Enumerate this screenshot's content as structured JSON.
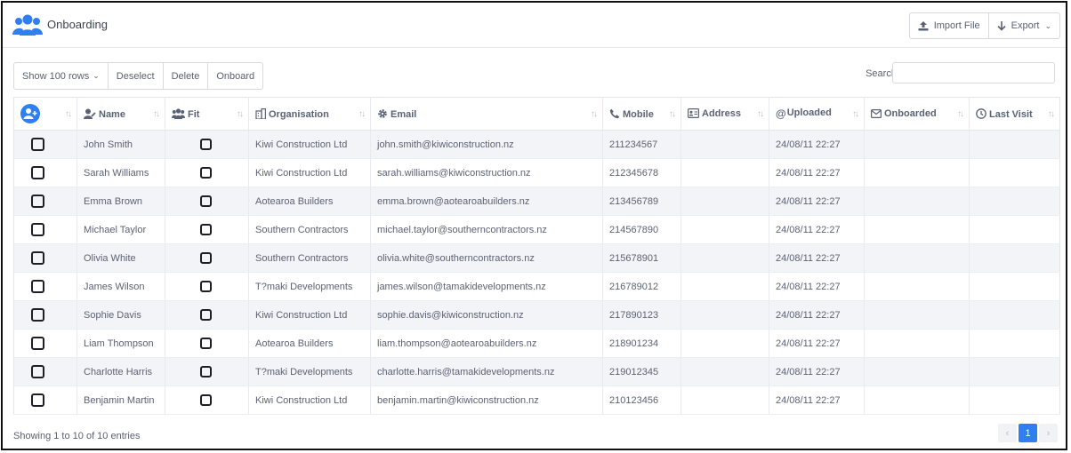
{
  "app": {
    "title": "Onboarding",
    "icon": "users-icon"
  },
  "header_actions": {
    "import_label": "Import File",
    "export_label": "Export"
  },
  "toolbar": {
    "show_rows_label": "Show 100 rows",
    "deselect_label": "Deselect",
    "delete_label": "Delete",
    "onboard_label": "Onboard"
  },
  "search": {
    "label": "Search:",
    "value": ""
  },
  "table": {
    "columns": [
      {
        "label": ""
      },
      {
        "label": "Name",
        "icon": "user-pen-icon"
      },
      {
        "label": "Fit",
        "icon": "users-icon"
      },
      {
        "label": "Organisation",
        "icon": "building-icon"
      },
      {
        "label": "Email",
        "icon": "gear-icon"
      },
      {
        "label": "Mobile",
        "icon": "phone-icon"
      },
      {
        "label": "Address",
        "icon": "address-card-icon"
      },
      {
        "label": "Uploaded",
        "icon": "at-icon"
      },
      {
        "label": "Onboarded",
        "icon": "envelope-icon"
      },
      {
        "label": "Last Visit",
        "icon": "clock-icon"
      }
    ],
    "rows": [
      {
        "name": "John Smith",
        "organisation": "Kiwi Construction Ltd",
        "email": "john.smith@kiwiconstruction.nz",
        "mobile": "211234567",
        "address": "",
        "uploaded": "24/08/11 22:27",
        "onboarded": "",
        "last_visit": ""
      },
      {
        "name": "Sarah Williams",
        "organisation": "Kiwi Construction Ltd",
        "email": "sarah.williams@kiwiconstruction.nz",
        "mobile": "212345678",
        "address": "",
        "uploaded": "24/08/11 22:27",
        "onboarded": "",
        "last_visit": ""
      },
      {
        "name": "Emma Brown",
        "organisation": "Aotearoa Builders",
        "email": "emma.brown@aotearoabuilders.nz",
        "mobile": "213456789",
        "address": "",
        "uploaded": "24/08/11 22:27",
        "onboarded": "",
        "last_visit": ""
      },
      {
        "name": "Michael Taylor",
        "organisation": "Southern Contractors",
        "email": "michael.taylor@southerncontractors.nz",
        "mobile": "214567890",
        "address": "",
        "uploaded": "24/08/11 22:27",
        "onboarded": "",
        "last_visit": ""
      },
      {
        "name": "Olivia White",
        "organisation": "Southern Contractors",
        "email": "olivia.white@southerncontractors.nz",
        "mobile": "215678901",
        "address": "",
        "uploaded": "24/08/11 22:27",
        "onboarded": "",
        "last_visit": ""
      },
      {
        "name": "James Wilson",
        "organisation": "T?maki Developments",
        "email": "james.wilson@tamakidevelopments.nz",
        "mobile": "216789012",
        "address": "",
        "uploaded": "24/08/11 22:27",
        "onboarded": "",
        "last_visit": ""
      },
      {
        "name": "Sophie Davis",
        "organisation": "Kiwi Construction Ltd",
        "email": "sophie.davis@kiwiconstruction.nz",
        "mobile": "217890123",
        "address": "",
        "uploaded": "24/08/11 22:27",
        "onboarded": "",
        "last_visit": ""
      },
      {
        "name": "Liam Thompson",
        "organisation": "Aotearoa Builders",
        "email": "liam.thompson@aotearoabuilders.nz",
        "mobile": "218901234",
        "address": "",
        "uploaded": "24/08/11 22:27",
        "onboarded": "",
        "last_visit": ""
      },
      {
        "name": "Charlotte Harris",
        "organisation": "T?maki Developments",
        "email": "charlotte.harris@tamakidevelopments.nz",
        "mobile": "219012345",
        "address": "",
        "uploaded": "24/08/11 22:27",
        "onboarded": "",
        "last_visit": ""
      },
      {
        "name": "Benjamin Martin",
        "organisation": "Kiwi Construction Ltd",
        "email": "benjamin.martin@kiwiconstruction.nz",
        "mobile": "210123456",
        "address": "",
        "uploaded": "24/08/11 22:27",
        "onboarded": "",
        "last_visit": ""
      }
    ]
  },
  "footer": {
    "info": "Showing 1 to 10 of 10 entries",
    "current_page": "1"
  },
  "colors": {
    "accent": "#2f7ff0",
    "stripe": "#f3f4f7"
  }
}
